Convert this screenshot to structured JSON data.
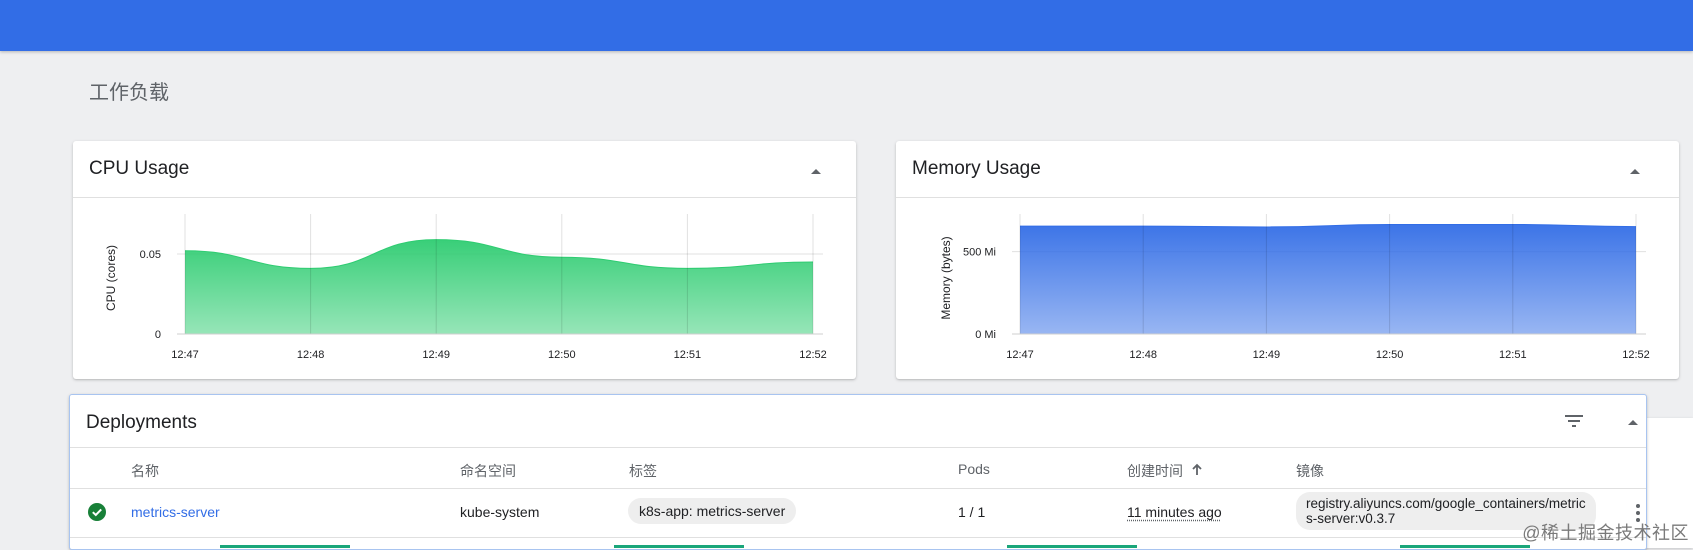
{
  "page": {
    "title": "工作负载"
  },
  "cpu_card": {
    "title": "CPU Usage"
  },
  "memory_card": {
    "title": "Memory Usage"
  },
  "chart_data": [
    {
      "type": "area",
      "title": "CPU Usage",
      "ylabel": "CPU (cores)",
      "x": [
        "12:47",
        "12:48",
        "12:49",
        "12:50",
        "12:51",
        "12:52"
      ],
      "series": [
        {
          "values": [
            0.052,
            0.041,
            0.059,
            0.048,
            0.041,
            0.045
          ]
        }
      ],
      "ytick_values": [
        0,
        0.05
      ],
      "ytick_labels": [
        "0",
        "0.05"
      ],
      "ylim": [
        0,
        0.07
      ],
      "color": "#2ecc71",
      "grid": true
    },
    {
      "type": "area",
      "title": "Memory Usage",
      "ylabel": "Memory (bytes)",
      "x": [
        "12:47",
        "12:48",
        "12:49",
        "12:50",
        "12:51",
        "12:52"
      ],
      "series": [
        {
          "values": [
            655,
            655,
            650,
            665,
            665,
            652
          ]
        }
      ],
      "ytick_values": [
        0,
        500
      ],
      "ytick_labels": [
        "0 Mi",
        "500 Mi"
      ],
      "ylim": [
        0,
        680
      ],
      "color": "#326de6",
      "grid": true
    }
  ],
  "deployments": {
    "title": "Deployments",
    "columns": {
      "name": "名称",
      "namespace": "命名空间",
      "labels": "标签",
      "pods": "Pods",
      "created": "创建时间",
      "images": "镜像"
    },
    "rows": [
      {
        "name": "metrics-server",
        "namespace": "kube-system",
        "label": "k8s-app: metrics-server",
        "pods": "1 / 1",
        "created": "11 minutes ago",
        "image_line1": "registry.aliyuncs.com/google_containers/metric",
        "image_line2": "s-server:v0.3.7"
      }
    ]
  },
  "icons": {
    "collapse": "chevron-up-icon",
    "filter": "filter-icon",
    "status": "check-circle-icon",
    "sort": "arrow-up-icon",
    "more": "more-vert-icon"
  },
  "colors": {
    "accent": "#326de6",
    "cpu": "#2ecc71",
    "success": "#188038"
  },
  "watermark": "@稀土掘金技术社区"
}
